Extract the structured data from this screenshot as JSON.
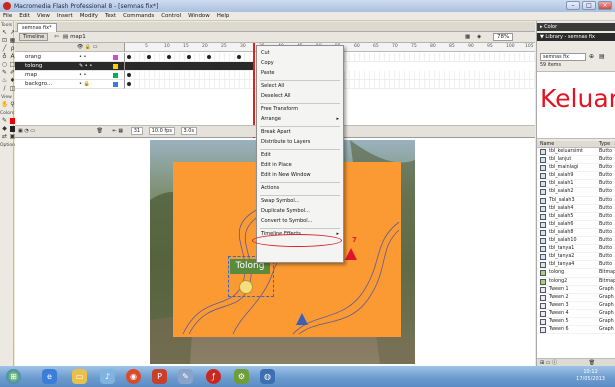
{
  "window": {
    "title": "Macromedia Flash Professional 8 - [semnas fix*]",
    "controls": [
      "–",
      "□",
      "×"
    ]
  },
  "menubar": [
    "File",
    "Edit",
    "View",
    "Insert",
    "Modify",
    "Text",
    "Commands",
    "Control",
    "Window",
    "Help"
  ],
  "tools": {
    "header": "Tools",
    "view_label": "View",
    "colors_label": "Colors",
    "options_label": "Options"
  },
  "document": {
    "tab": "semnas fix*",
    "timeline_button": "Timeline",
    "scene": "map1",
    "zoom": "78%"
  },
  "timeline": {
    "frame_numbers": [
      "5",
      "10",
      "15",
      "20",
      "25",
      "30",
      "35",
      "40",
      "45",
      "50",
      "55",
      "60",
      "65",
      "70",
      "75",
      "80",
      "85",
      "90",
      "95",
      "100",
      "105"
    ],
    "layers": [
      {
        "name": "orang",
        "selected": false
      },
      {
        "name": "tolong",
        "selected": true
      },
      {
        "name": "map",
        "selected": false
      },
      {
        "name": "backgro...",
        "selected": false
      }
    ],
    "footer": {
      "frame": "31",
      "fps": "10.0 fps",
      "time": "3.0s"
    }
  },
  "stage": {
    "symbol_label": "Tolong",
    "annotation_number": "7"
  },
  "context_menu": {
    "items": [
      {
        "label": "Cut",
        "submenu": false,
        "sep_after": false
      },
      {
        "label": "Copy",
        "submenu": false,
        "sep_after": false
      },
      {
        "label": "Paste",
        "submenu": false,
        "sep_after": true
      },
      {
        "label": "Select All",
        "submenu": false,
        "sep_after": false
      },
      {
        "label": "Deselect All",
        "submenu": false,
        "sep_after": true
      },
      {
        "label": "Free Transform",
        "submenu": false,
        "sep_after": false
      },
      {
        "label": "Arrange",
        "submenu": true,
        "sep_after": true
      },
      {
        "label": "Break Apart",
        "submenu": false,
        "sep_after": false
      },
      {
        "label": "Distribute to Layers",
        "submenu": false,
        "sep_after": true
      },
      {
        "label": "Edit",
        "submenu": false,
        "sep_after": false
      },
      {
        "label": "Edit in Place",
        "submenu": false,
        "sep_after": false
      },
      {
        "label": "Edit in New Window",
        "submenu": false,
        "sep_after": true
      },
      {
        "label": "Actions",
        "submenu": false,
        "sep_after": true
      },
      {
        "label": "Swap Symbol...",
        "submenu": false,
        "sep_after": false
      },
      {
        "label": "Duplicate Symbol...",
        "submenu": false,
        "sep_after": false
      },
      {
        "label": "Convert to Symbol...",
        "submenu": false,
        "sep_after": true
      },
      {
        "label": "Timeline Effects",
        "submenu": true,
        "sep_after": false
      }
    ],
    "highlighted": "Convert to Symbol..."
  },
  "panels": {
    "color_header": "▸ Color",
    "library_header": "▼ Library - semnas fix",
    "library_selector": "semnas fix",
    "item_count": "59 items",
    "preview_text": "Keluar",
    "columns": {
      "name": "Name",
      "type": "Type"
    },
    "items": [
      {
        "name": "tbl_keluarsimt",
        "type": "Butto"
      },
      {
        "name": "tbl_lanjut",
        "type": "Butto"
      },
      {
        "name": "tbl_mainlagi",
        "type": "Butto"
      },
      {
        "name": "tbl_salah9",
        "type": "Butto"
      },
      {
        "name": "tbl_salah1",
        "type": "Butto"
      },
      {
        "name": "tbl_salah2",
        "type": "Butto"
      },
      {
        "name": "Tbl_salah3",
        "type": "Butto"
      },
      {
        "name": "tbl_salah4",
        "type": "Butto"
      },
      {
        "name": "tbl_salah5",
        "type": "Butto"
      },
      {
        "name": "tbl_salah6",
        "type": "Butto"
      },
      {
        "name": "tbl_salah8",
        "type": "Butto"
      },
      {
        "name": "tbl_salah10",
        "type": "Butto"
      },
      {
        "name": "tbl_tanya1",
        "type": "Butto"
      },
      {
        "name": "tbl_tanya2",
        "type": "Butto"
      },
      {
        "name": "tbl_tanya4",
        "type": "Butto"
      },
      {
        "name": "tolong",
        "type": "Bitmap"
      },
      {
        "name": "tolong2",
        "type": "Bitmap"
      },
      {
        "name": "Tween 1",
        "type": "Graph"
      },
      {
        "name": "Tween 2",
        "type": "Graph"
      },
      {
        "name": "Tween 3",
        "type": "Graph"
      },
      {
        "name": "Tween 4",
        "type": "Graph"
      },
      {
        "name": "Tween 5",
        "type": "Graph"
      },
      {
        "name": "Tween 6",
        "type": "Graph"
      }
    ]
  },
  "taskbar": {
    "clock_time": "10:12",
    "clock_date": "17/05/2013"
  },
  "colors": {
    "accent_red": "#e3141f",
    "stage_orange": "#fb9a33",
    "highlight_circle": "#d8212a"
  }
}
